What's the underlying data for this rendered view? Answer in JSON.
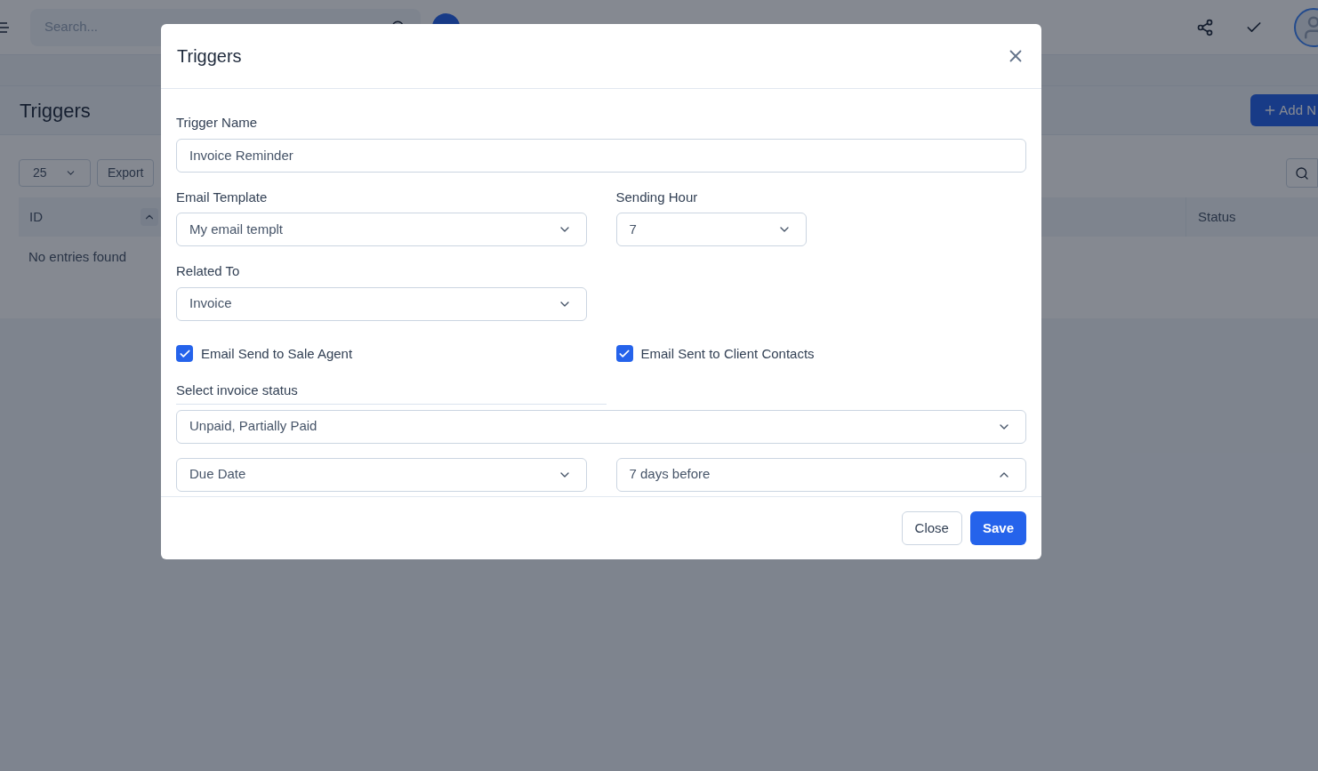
{
  "background": {
    "search": {
      "placeholder": "Search..."
    },
    "title": "Triggers",
    "add_button": "Add N",
    "table": {
      "page_size": "25",
      "export": "Export",
      "columns": [
        "ID",
        "Status"
      ],
      "empty": "No entries found"
    }
  },
  "modal": {
    "title": "Triggers",
    "trigger_name": {
      "label": "Trigger Name",
      "value": "Invoice Reminder"
    },
    "email_template": {
      "label": "Email Template",
      "value": "My email templt",
      "expanded": false
    },
    "sending_hour": {
      "label": "Sending Hour",
      "value": "7",
      "expanded": false
    },
    "related_to": {
      "label": "Related To",
      "value": "Invoice",
      "expanded": false
    },
    "checkboxes": [
      {
        "label": "Email Send to Sale Agent",
        "checked": true
      },
      {
        "label": "Email Sent to Client Contacts",
        "checked": true
      }
    ],
    "invoice_status": {
      "label": "Select invoice status",
      "value": "Unpaid, Partially Paid",
      "expanded": false
    },
    "date_field": {
      "value": "Due Date",
      "expanded": false
    },
    "offset": {
      "value": "7 days before",
      "expanded": true
    },
    "buttons": [
      {
        "label": "Close",
        "kind": "secondary"
      },
      {
        "label": "Save",
        "kind": "primary"
      }
    ]
  }
}
